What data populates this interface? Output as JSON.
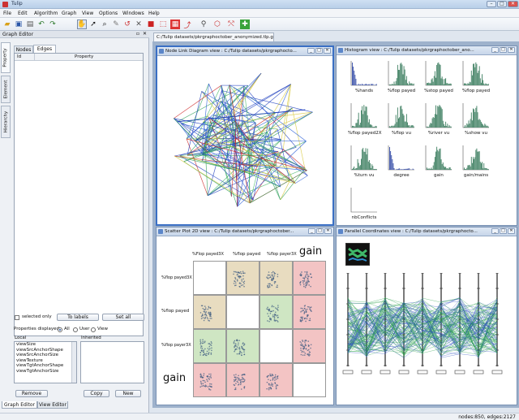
{
  "window": {
    "title": "Tulip",
    "controls": [
      "–",
      "□",
      "✕"
    ]
  },
  "menu": [
    "File",
    "Edit",
    "Algorithm",
    "Graph",
    "View",
    "Options",
    "Windows",
    "Help"
  ],
  "toolbar_icons": [
    "open-icon",
    "save-icon",
    "print-icon",
    "undo-icon",
    "redo-icon",
    "hand-icon",
    "select-icon",
    "zoom-icon",
    "picker-icon",
    "edit-icon",
    "delete-icon",
    "node-icon",
    "edge-icon",
    "shape-icon",
    "bend-icon",
    "magic-icon",
    "rect-select-icon",
    "lasso-icon",
    "highlight-icon"
  ],
  "graph_editor": {
    "title": "Graph Editor",
    "vertical_tabs": [
      "Property",
      "Element",
      "Hierarchy"
    ],
    "tabs": [
      "Nodes",
      "Edges"
    ],
    "active_tab": "Edges",
    "columns": [
      "Id",
      "Property"
    ],
    "selected_only_label": "selected only",
    "to_labels": "To labels",
    "set_all": "Set all",
    "properties_displayed_label": "Properties displayed :",
    "radio_all": "All",
    "radio_user": "User",
    "radio_view": "View",
    "local_label": "Local",
    "inherited_label": "Inherited",
    "local_list": [
      "viewSize",
      "viewSrcAnchorShape",
      "viewSrcAnchorSize",
      "viewTexture",
      "viewTgtAnchorShape",
      "viewTgtAnchorSize"
    ],
    "remove": "Remove",
    "copy": "Copy",
    "new": "New"
  },
  "bottom_tabs": [
    "Graph Editor",
    "View Editor"
  ],
  "document_tab": "C:/Tulip datasets/pkrgraphoctober_anonymized.tlp.gz",
  "views": {
    "node_link": "Node Link Diagram view : C:/Tulip datasets/pkrgraphocto...",
    "histogram": "Histogram view : C:/Tulip datasets/pkrgraphoctober_ano...",
    "scatter": "Scatter Plot 2D view : C:/Tulip datasets/pkrgraphoctober...",
    "parallel": "Parallel Coordinates view : C:/Tulip datasets/pkrgraphocto..."
  },
  "histogram_labels": [
    "%hands",
    "%flop payed",
    "%stop payed",
    "%flop payed",
    "%flop payed2X",
    "%flop vu",
    "%river vu",
    "%show vu",
    "%turn vu",
    "degree",
    "gain",
    "gain/mains",
    "nbConflicts"
  ],
  "scatter": {
    "col_labels": [
      "%Flop payed3X",
      "%flop payed",
      "%flop payer3X",
      "gain"
    ],
    "row_labels": [
      "%flop payed3X",
      "%flop payed",
      "%flop payer3X",
      "gain"
    ]
  },
  "status": "nodes:850, edges:2127",
  "colors": {
    "accent": "#3a6fc4",
    "histogram_bars": "#4f8a6f",
    "scatter_positive": "#cfe6c3",
    "scatter_neutral": "#e8dcc0",
    "scatter_negative": "#f3c4c4"
  }
}
